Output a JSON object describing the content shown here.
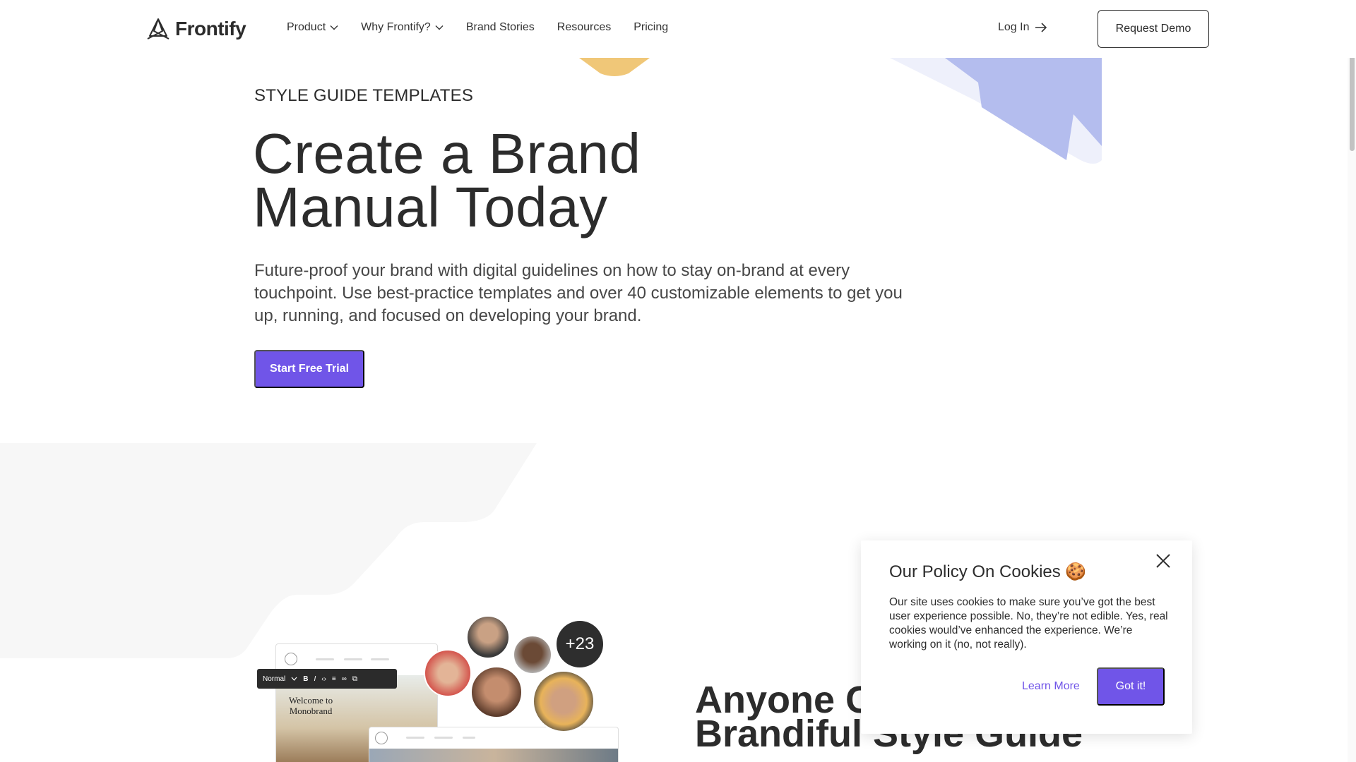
{
  "brand": {
    "name": "Frontify"
  },
  "nav": {
    "items": [
      {
        "label": "Product",
        "has_dropdown": true
      },
      {
        "label": "Why Frontify?",
        "has_dropdown": true
      },
      {
        "label": "Brand Stories",
        "has_dropdown": false
      },
      {
        "label": "Resources",
        "has_dropdown": false
      },
      {
        "label": "Pricing",
        "has_dropdown": false
      }
    ],
    "login_label": "Log In",
    "demo_label": "Request Demo"
  },
  "hero": {
    "eyebrow": "STYLE GUIDE TEMPLATES",
    "headline_line1": "Create a Brand",
    "headline_line2": "Manual Today",
    "subtext": "Future-proof your brand with digital guidelines on how to stay on-brand at every touchpoint. Use best-practice templates and over 40 customizable elements to get you up, running, and focused on developing your brand.",
    "cta_label": "Start Free Trial"
  },
  "section2": {
    "headline_line1": "Anyone Ca",
    "headline_line2": "Brandiful Style Guide"
  },
  "mockup": {
    "card_title_line1": "Welcome to",
    "card_title_line2": "Monobrand",
    "toolbar_style": "Normal",
    "toolbar_buttons": [
      "B",
      "I"
    ],
    "avatar_count_label": "+23"
  },
  "cookie": {
    "title": "Our Policy On Cookies 🍪",
    "body": "Our site uses cookies to make sure you’ve got the best user experience possible. No, they’re not edible. Yes, real cookies would’ve enhanced the experience. We’re working on it (no, not really).",
    "learn_more_label": "Learn More",
    "accept_label": "Got it!"
  },
  "colors": {
    "accent": "#7055e8",
    "text": "#2c2c2c",
    "deco_yellow": "#f0c778",
    "deco_blue": "#b4bdee"
  }
}
